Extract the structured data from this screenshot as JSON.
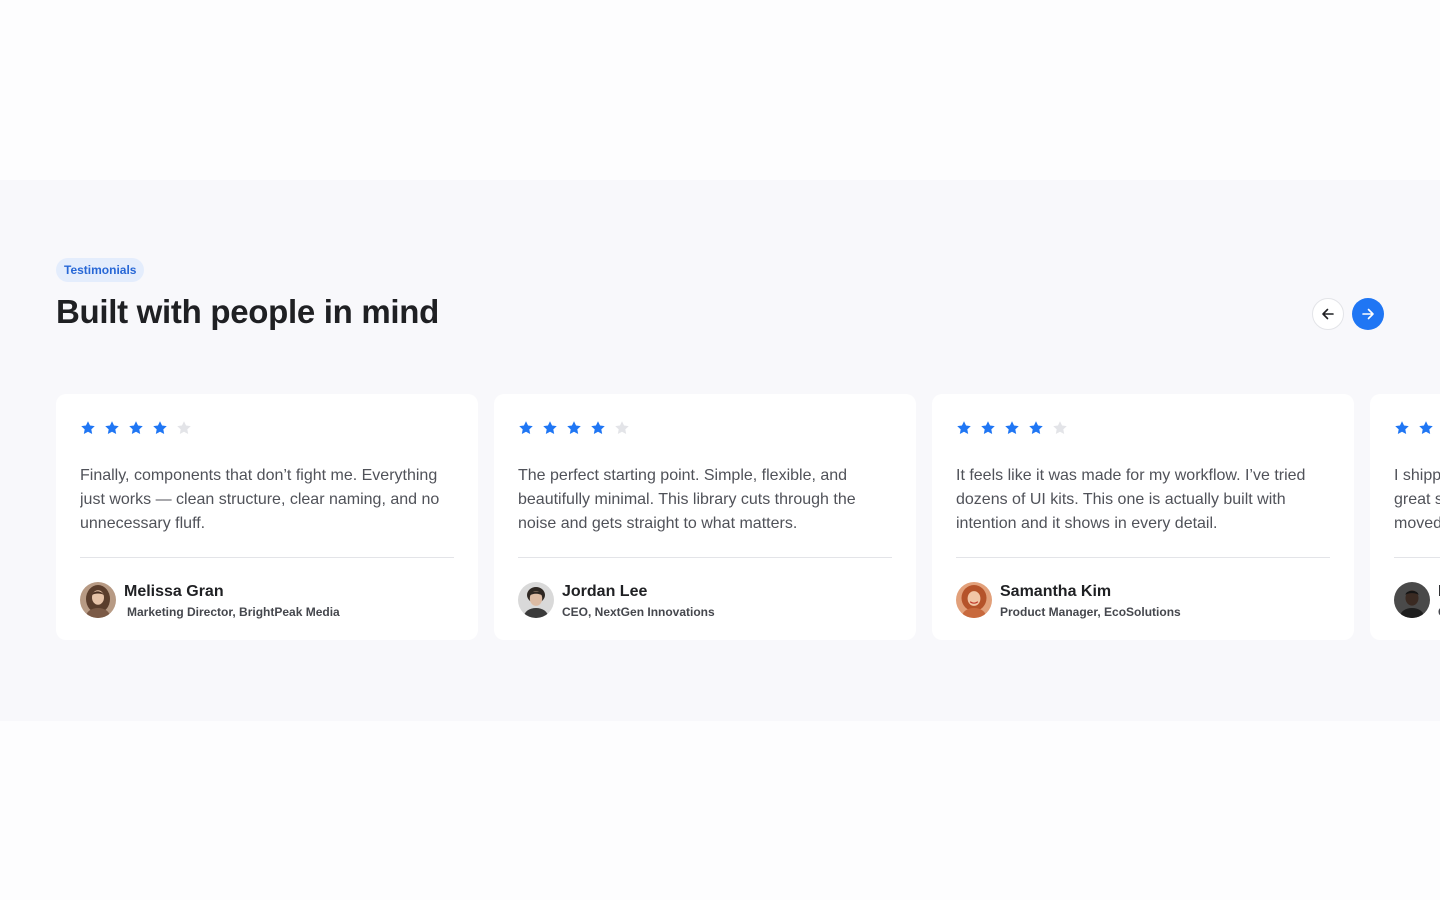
{
  "section": {
    "badge": "Testimonials",
    "title": "Built with people in mind",
    "nav": {
      "prev_icon": "arrow-left-icon",
      "next_icon": "arrow-right-icon"
    }
  },
  "colors": {
    "accent": "#1f76f4",
    "star_filled": "#1f76f4",
    "star_empty": "#e3e4e8",
    "badge_bg": "#e4edfc",
    "badge_text": "#2767d6"
  },
  "testimonials": [
    {
      "rating": 4,
      "max_rating": 5,
      "quote": "Finally, components that don’t fight me. Everything just works — clean structure, clear naming, and no unnecessary fluff.",
      "name": "Melissa Gran",
      "role": "Marketing Director, BrightPeak Media"
    },
    {
      "rating": 4,
      "max_rating": 5,
      "quote": "The perfect starting point. Simple, flexible, and beautifully minimal. This library cuts through the noise and gets straight to what matters.",
      "name": "Jordan Lee",
      "role": "CEO, NextGen Innovations"
    },
    {
      "rating": 4,
      "max_rating": 5,
      "quote": "It feels like it was made for my workflow. I’ve tried dozens of UI kits. This one is actually built with intention and it shows in every detail.",
      "name": "Samantha Kim",
      "role": "Product Manager, EcoSolutions"
    },
    {
      "rating": 2,
      "max_rating": 2,
      "quote": "I shipp great s moved",
      "name": "I",
      "role": "C"
    }
  ]
}
